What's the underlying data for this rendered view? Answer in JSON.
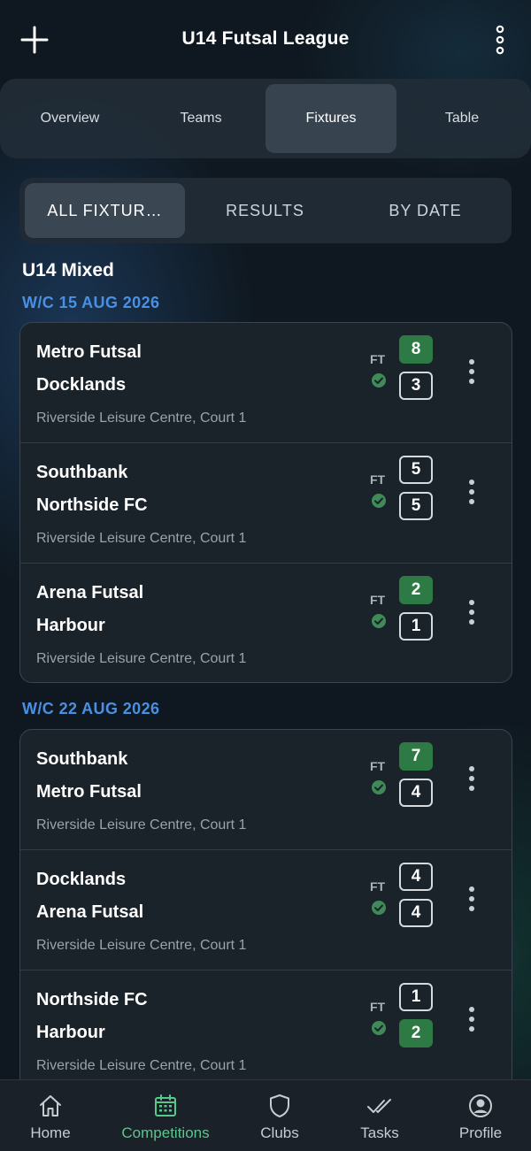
{
  "app": {
    "title": "U14 Futsal League"
  },
  "tabs": [
    {
      "label": "Overview",
      "active": false
    },
    {
      "label": "Teams",
      "active": false
    },
    {
      "label": "Fixtures",
      "active": true
    },
    {
      "label": "Table",
      "active": false
    }
  ],
  "segments": [
    {
      "label": "ALL FIXTUR…",
      "active": true
    },
    {
      "label": "RESULTS",
      "active": false
    },
    {
      "label": "BY DATE",
      "active": false
    }
  ],
  "group_title": "U14 Mixed",
  "weeks": [
    {
      "label": "W/C 15 AUG 2026",
      "matches": [
        {
          "home": "Metro Futsal",
          "away": "Docklands",
          "home_score": "8",
          "away_score": "3",
          "winner": "home",
          "status": "FT",
          "venue": "Riverside Leisure Centre, Court 1"
        },
        {
          "home": "Southbank",
          "away": "Northside FC",
          "home_score": "5",
          "away_score": "5",
          "winner": "none",
          "status": "FT",
          "venue": "Riverside Leisure Centre, Court 1"
        },
        {
          "home": "Arena Futsal",
          "away": "Harbour",
          "home_score": "2",
          "away_score": "1",
          "winner": "home",
          "status": "FT",
          "venue": "Riverside Leisure Centre, Court 1"
        }
      ]
    },
    {
      "label": "W/C 22 AUG 2026",
      "matches": [
        {
          "home": "Southbank",
          "away": "Metro Futsal",
          "home_score": "7",
          "away_score": "4",
          "winner": "home",
          "status": "FT",
          "venue": "Riverside Leisure Centre, Court 1"
        },
        {
          "home": "Docklands",
          "away": "Arena Futsal",
          "home_score": "4",
          "away_score": "4",
          "winner": "none",
          "status": "FT",
          "venue": "Riverside Leisure Centre, Court 1"
        },
        {
          "home": "Northside FC",
          "away": "Harbour",
          "home_score": "1",
          "away_score": "2",
          "winner": "away",
          "status": "FT",
          "venue": "Riverside Leisure Centre, Court 1"
        }
      ]
    }
  ],
  "bottom_nav": [
    {
      "label": "Home",
      "icon": "home-icon",
      "active": false
    },
    {
      "label": "Competitions",
      "icon": "calendar-icon",
      "active": true
    },
    {
      "label": "Clubs",
      "icon": "shield-icon",
      "active": false
    },
    {
      "label": "Tasks",
      "icon": "double-check-icon",
      "active": false
    },
    {
      "label": "Profile",
      "icon": "profile-icon",
      "active": false
    }
  ],
  "colors": {
    "accent_blue": "#4a90e2",
    "win_green": "#2e7a44",
    "active_nav": "#57c98a",
    "background": "#0f1820"
  }
}
